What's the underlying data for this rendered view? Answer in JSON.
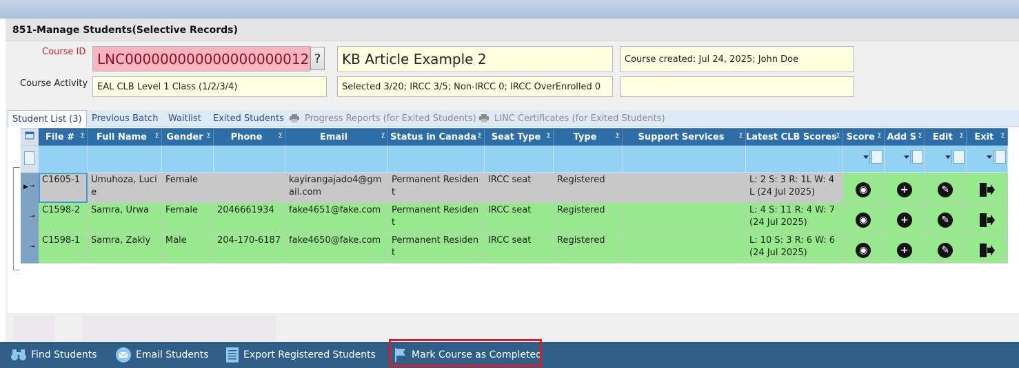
{
  "form": {
    "title": "851-Manage Students(Selective Records)",
    "course_id_label": "Course ID",
    "course_id_value": "LNC000000000000000000012",
    "lookup_button": "?",
    "course_name": "KB Article Example 2",
    "course_created": "Course created: Jul 24, 2025;  John Doe",
    "course_activity_label": "Course Activity",
    "course_activity_value": "EAL CLB Level 1 Class (1/2/3/4)",
    "selection_summary": "Selected 3/20; IRCC 3/5; Non-IRCC 0; IRCC OverEnrolled 0",
    "empty_field": ""
  },
  "tabs": [
    {
      "label": "Student List (3)"
    },
    {
      "label": "Previous Batch"
    },
    {
      "label": "Waitlist"
    },
    {
      "label": "Exited Students"
    },
    {
      "label": "Progress Reports (for Exited Students)"
    },
    {
      "label": "LINC Certificates (for Exited Students)"
    }
  ],
  "grid": {
    "columns": [
      "File #",
      "Full Name",
      "Gender",
      "Phone",
      "Email",
      "Status in Canada",
      "Seat Type",
      "Type",
      "Support Services",
      "Latest CLB Scores",
      "Score",
      "Add S",
      "Edit",
      "Exit"
    ],
    "sigma": "Σ",
    "rows": [
      {
        "file": "C1605-1",
        "name": "Umuhoza, Lucie",
        "gender": "Female",
        "phone": "",
        "email": "kayirangajado4@gmail.com",
        "status": "Permanent Resident",
        "seat": "IRCC seat",
        "type": "Registered",
        "support": "",
        "clb": "L: 2 S: 3 R: 1L W: 4L (24 Jul 2025)"
      },
      {
        "file": "C1598-2",
        "name": "Samra, Urwa",
        "gender": "Female",
        "phone": "2046661934",
        "email": "fake4651@fake.com",
        "status": "Permanent Resident",
        "seat": "IRCC seat",
        "type": "Registered",
        "support": "",
        "clb": "L: 4 S: 11 R: 4 W: 7 (24 Jul 2025)"
      },
      {
        "file": "C1598-1",
        "name": "Samra, Zakiy",
        "gender": "Male",
        "phone": "204-170-6187",
        "email": "fake4650@fake.com",
        "status": "Permanent Resident",
        "seat": "IRCC seat",
        "type": "Registered",
        "support": "",
        "clb": "L: 10 S: 3 R: 6 W: 6 (24 Jul 2025)"
      }
    ]
  },
  "toolbar": {
    "find": "Find Students",
    "email": "Email Students",
    "export": "Export Registered Students",
    "complete": "Mark Course as Completed"
  },
  "colors": {
    "header": "#2d6ea8",
    "row_selected": "#c8c8c8",
    "row_registered": "#98e88e",
    "course_id_bg": "#f9b6c1",
    "toolbar_bg": "#2f5f86",
    "highlight": "#e01b24"
  }
}
